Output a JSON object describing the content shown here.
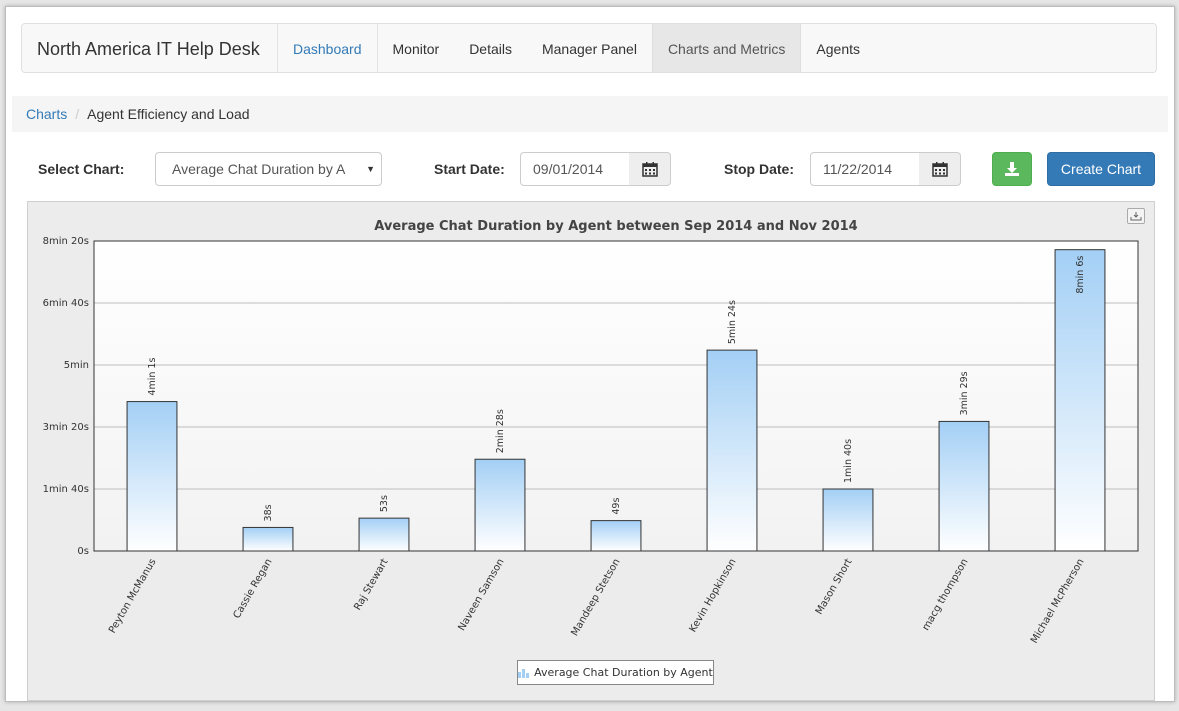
{
  "navbar": {
    "brand": "North America IT Help Desk",
    "items": [
      {
        "label": "Dashboard"
      },
      {
        "label": "Monitor"
      },
      {
        "label": "Details"
      },
      {
        "label": "Manager Panel"
      },
      {
        "label": "Charts and Metrics"
      },
      {
        "label": "Agents"
      }
    ]
  },
  "breadcrumb": {
    "parent": "Charts",
    "current": "Agent Efficiency and Load"
  },
  "controls": {
    "select_label": "Select Chart:",
    "select_value": "Average Chat Duration by A",
    "start_label": "Start Date:",
    "start_value": "09/01/2014",
    "stop_label": "Stop Date:",
    "stop_value": "11/22/2014",
    "create_label": "Create Chart",
    "download_icon": "download-icon",
    "calendar_icon": "calendar-icon"
  },
  "chart_data": {
    "type": "bar",
    "title": "Average Chat Duration by Agent between Sep 2014 and Nov 2014",
    "categories": [
      "Peyton McManus",
      "Cassie Regan",
      "Raj Stewart",
      "Naveen Samson",
      "Mandeep Stetson",
      "Kevin Hopkinson",
      "Mason Short",
      "macg thompson",
      "Michael McPherson"
    ],
    "series": [
      {
        "name": "Average Chat Duration by Agent",
        "values": [
          241,
          38,
          53,
          148,
          49,
          324,
          100,
          209,
          486
        ],
        "labels": [
          "4min 1s",
          "38s",
          "53s",
          "2min 28s",
          "49s",
          "5min 24s",
          "1min 40s",
          "3min 29s",
          "8min 6s"
        ]
      }
    ],
    "ylim": [
      0,
      500
    ],
    "yticks": [
      {
        "value": 0,
        "label": "0s"
      },
      {
        "value": 100,
        "label": "1min 40s"
      },
      {
        "value": 200,
        "label": "3min 20s"
      },
      {
        "value": 300,
        "label": "5min"
      },
      {
        "value": 400,
        "label": "6min 40s"
      },
      {
        "value": 500,
        "label": "8min 20s"
      }
    ],
    "grid": true,
    "legend": "bottom-center",
    "colors": {
      "bar_top": "#a3cff5",
      "bar_bottom": "#ffffff",
      "bar_stroke": "#333333"
    }
  }
}
